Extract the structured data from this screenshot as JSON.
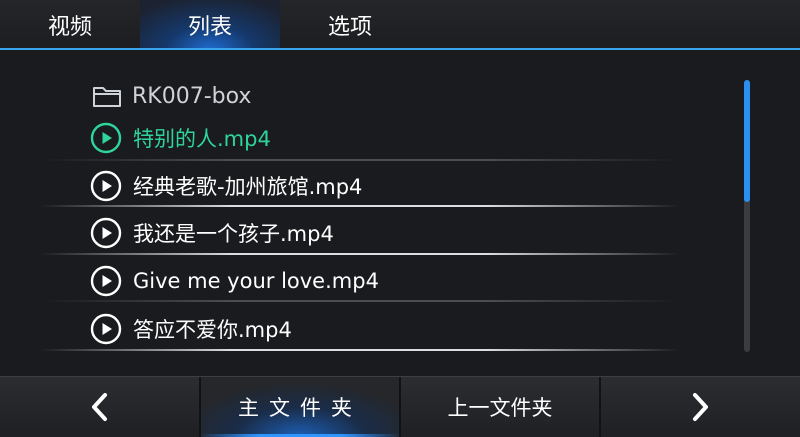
{
  "tabs": [
    {
      "label": "视频",
      "active": false
    },
    {
      "label": "列表",
      "active": true
    },
    {
      "label": "选项",
      "active": false
    }
  ],
  "list": {
    "folder": {
      "name": "RK007-box",
      "icon": "folder-icon"
    },
    "files": [
      {
        "name": "特别的人.mp4",
        "icon": "play-circle-icon",
        "playing": true
      },
      {
        "name": "经典老歌-加州旅馆.mp4",
        "icon": "play-circle-icon",
        "playing": false
      },
      {
        "name": "我还是一个孩子.mp4",
        "icon": "play-circle-icon",
        "playing": false
      },
      {
        "name": "Give me your love.mp4",
        "icon": "play-circle-icon",
        "playing": false
      },
      {
        "name": "答应不爱你.mp4",
        "icon": "play-circle-icon",
        "playing": false
      }
    ],
    "scroll_position_fraction": 0.0
  },
  "bottom": {
    "prev_icon": "chevron-left-icon",
    "home_folder_label": "主文件夹",
    "parent_folder_label": "上一文件夹",
    "next_icon": "chevron-right-icon"
  },
  "colors": {
    "accent_blue": "#3aa5ee",
    "playing_green": "#2fd49a",
    "background": "#1a1b1e"
  }
}
